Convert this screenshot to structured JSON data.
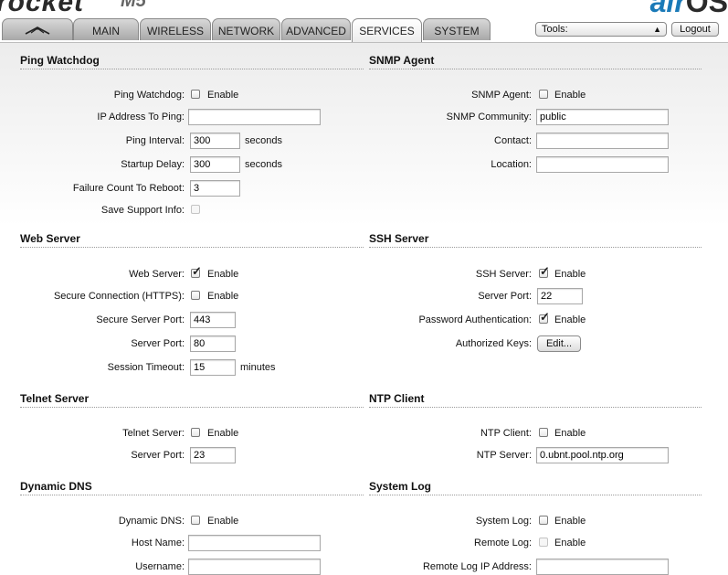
{
  "header": {
    "brand": "rocket",
    "brand_sub": "M5",
    "corner_a": "air",
    "corner_b": "OS",
    "tabs": [
      {
        "label": ""
      },
      {
        "label": "MAIN"
      },
      {
        "label": "WIRELESS"
      },
      {
        "label": "NETWORK"
      },
      {
        "label": "ADVANCED"
      },
      {
        "label": "SERVICES"
      },
      {
        "label": "SYSTEM"
      }
    ],
    "active_tab": "SERVICES",
    "tools_selected": "Tools:",
    "logout_label": "Logout"
  },
  "ping_watchdog": {
    "title": "Ping Watchdog",
    "enable_label": "Ping Watchdog:",
    "enable_text": "Enable",
    "enabled": false,
    "ip_label": "IP Address To Ping:",
    "ip_value": "",
    "interval_label": "Ping Interval:",
    "interval_value": "300",
    "interval_unit": "seconds",
    "startup_label": "Startup Delay:",
    "startup_value": "300",
    "startup_unit": "seconds",
    "failure_label": "Failure Count To Reboot:",
    "failure_value": "3",
    "support_label": "Save Support Info:",
    "support_checked": false
  },
  "snmp_agent": {
    "title": "SNMP Agent",
    "enable_label": "SNMP Agent:",
    "enable_text": "Enable",
    "enabled": false,
    "community_label": "SNMP Community:",
    "community_value": "public",
    "contact_label": "Contact:",
    "contact_value": "",
    "location_label": "Location:",
    "location_value": ""
  },
  "web_server": {
    "title": "Web Server",
    "enable_label": "Web Server:",
    "enable_text": "Enable",
    "enabled": true,
    "https_label": "Secure Connection (HTTPS):",
    "https_text": "Enable",
    "https_enabled": false,
    "secure_port_label": "Secure Server Port:",
    "secure_port_value": "443",
    "port_label": "Server Port:",
    "port_value": "80",
    "timeout_label": "Session Timeout:",
    "timeout_value": "15",
    "timeout_unit": "minutes"
  },
  "ssh_server": {
    "title": "SSH Server",
    "enable_label": "SSH Server:",
    "enable_text": "Enable",
    "enabled": true,
    "port_label": "Server Port:",
    "port_value": "22",
    "password_label": "Password Authentication:",
    "password_text": "Enable",
    "password_enabled": true,
    "keys_label": "Authorized Keys:",
    "keys_button": "Edit..."
  },
  "telnet_server": {
    "title": "Telnet Server",
    "enable_label": "Telnet Server:",
    "enable_text": "Enable",
    "enabled": false,
    "port_label": "Server Port:",
    "port_value": "23"
  },
  "ntp_client": {
    "title": "NTP Client",
    "enable_label": "NTP Client:",
    "enable_text": "Enable",
    "enabled": false,
    "server_label": "NTP Server:",
    "server_value": "0.ubnt.pool.ntp.org"
  },
  "dynamic_dns": {
    "title": "Dynamic DNS",
    "enable_label": "Dynamic DNS:",
    "enable_text": "Enable",
    "enabled": false,
    "host_label": "Host Name:",
    "host_value": "",
    "user_label": "Username:",
    "user_value": ""
  },
  "system_log": {
    "title": "System Log",
    "enable_label": "System Log:",
    "enable_text": "Enable",
    "enabled": false,
    "remote_label": "Remote Log:",
    "remote_text": "Enable",
    "remote_enabled": false,
    "remote_ip_label": "Remote Log IP Address:",
    "remote_ip_value": ""
  },
  "icons": {
    "tab0": "ubiquiti-logo-icon",
    "tools_arrow": "updown-arrow-icon",
    "check": "checkmark-icon"
  }
}
